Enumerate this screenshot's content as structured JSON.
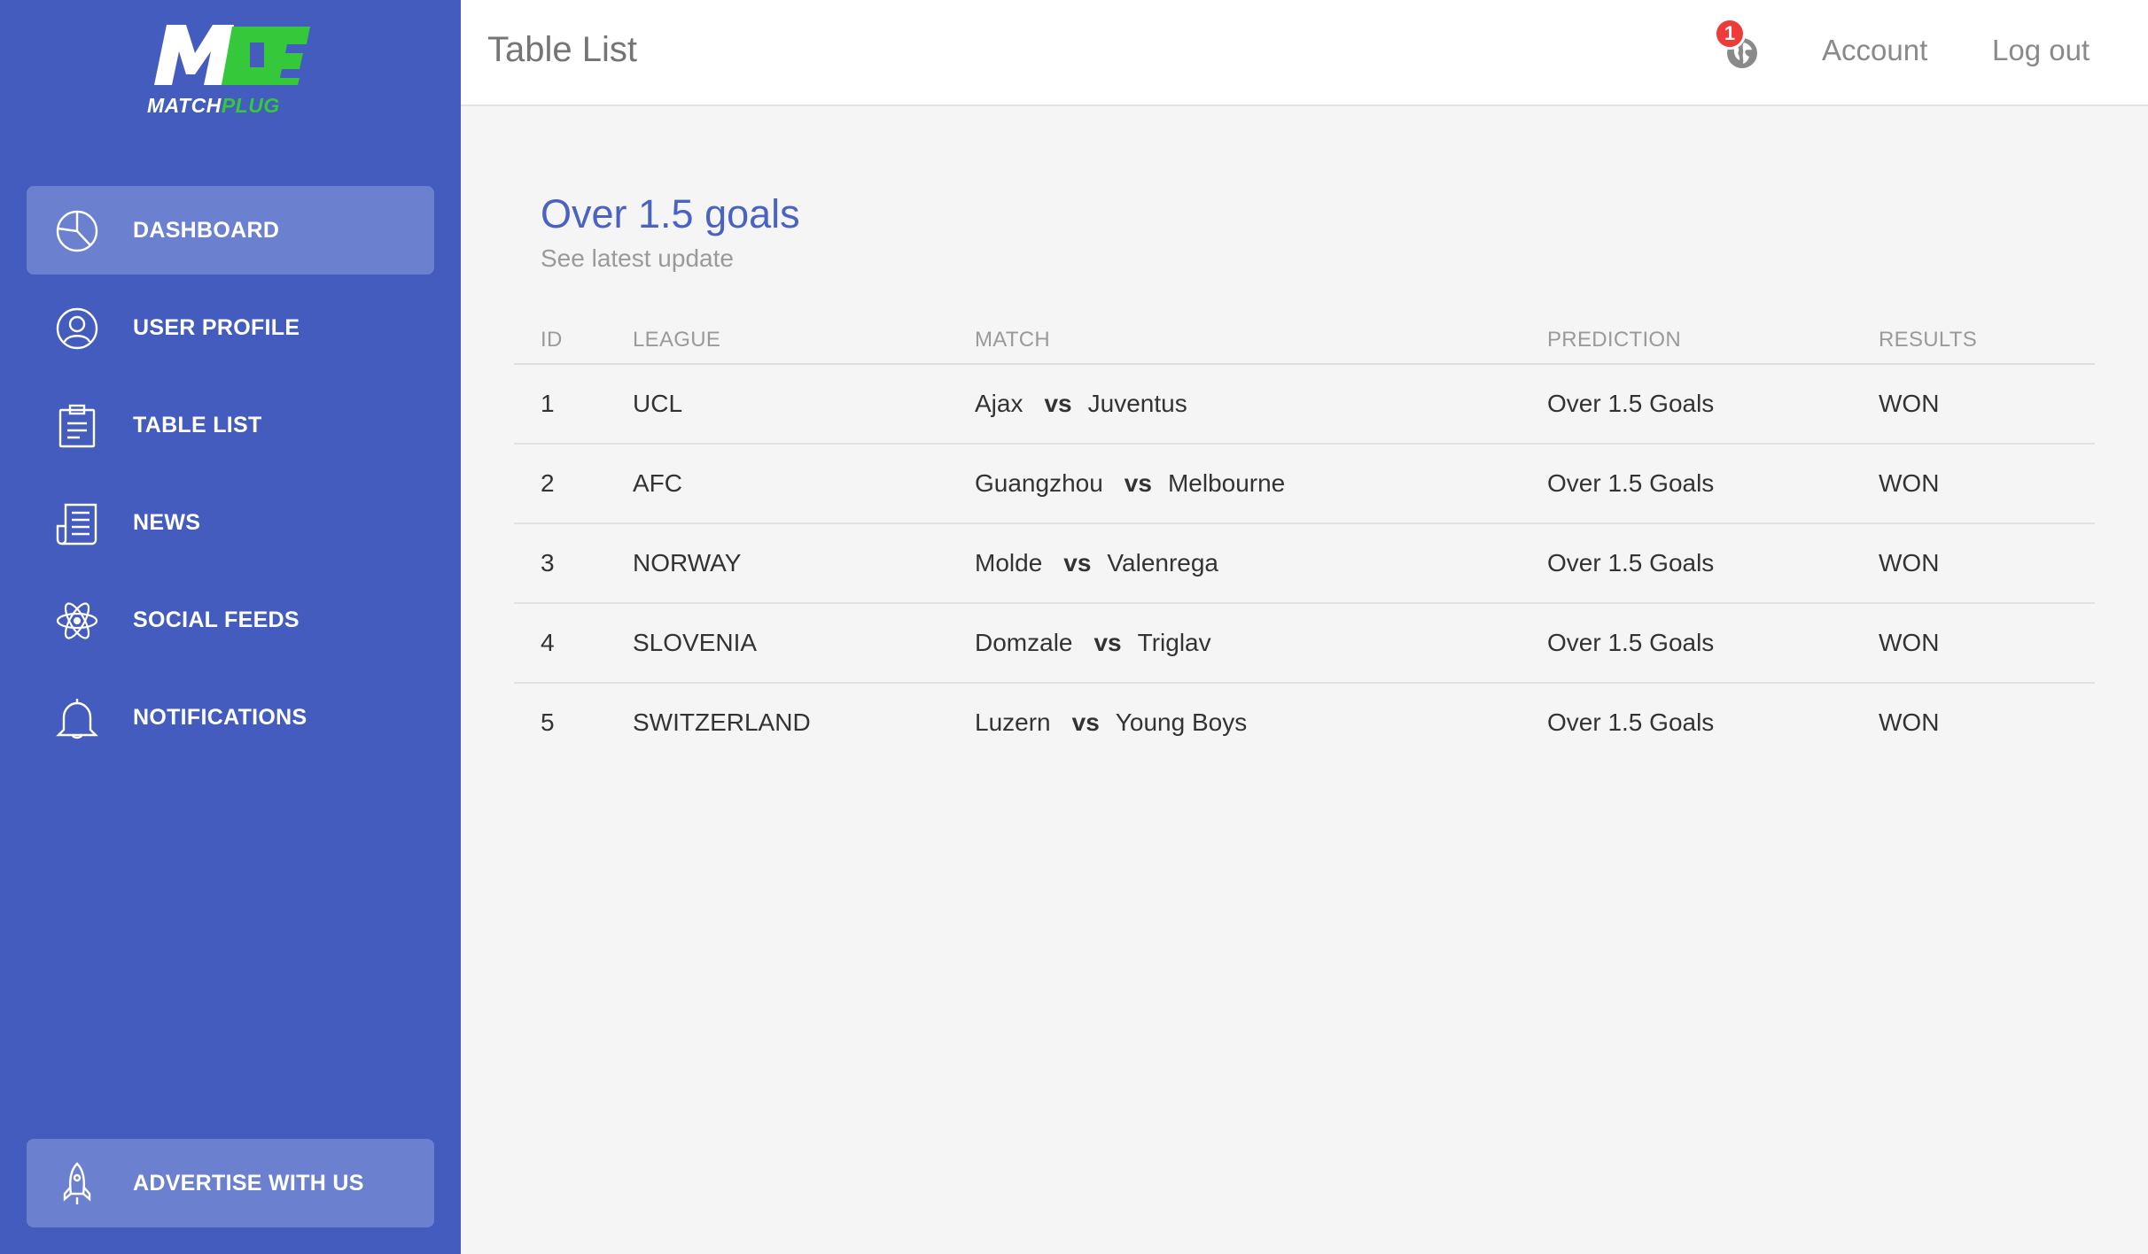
{
  "brand": {
    "name_white": "MATCH",
    "name_green": "PLUG",
    "green": "#34c83a",
    "sidebar_color": "#435cbd"
  },
  "sidebar": {
    "items": [
      {
        "label": "DASHBOARD",
        "icon": "pie-chart-icon",
        "active": true
      },
      {
        "label": "USER PROFILE",
        "icon": "user-icon",
        "active": false
      },
      {
        "label": "TABLE LIST",
        "icon": "clipboard-icon",
        "active": false
      },
      {
        "label": "NEWS",
        "icon": "newspaper-icon",
        "active": false
      },
      {
        "label": "SOCIAL FEEDS",
        "icon": "atom-icon",
        "active": false
      },
      {
        "label": "NOTIFICATIONS",
        "icon": "bell-icon",
        "active": false
      }
    ],
    "advertise_label": "ADVERTISE WITH US"
  },
  "header": {
    "title": "Table List",
    "notification_count": "1",
    "account_label": "Account",
    "logout_label": "Log out"
  },
  "card": {
    "title": "Over 1.5 goals",
    "subtitle": "See latest update"
  },
  "table": {
    "columns": [
      "ID",
      "LEAGUE",
      "MATCH",
      "PREDICTION",
      "RESULTS"
    ],
    "vs_label": "vs",
    "rows": [
      {
        "id": "1",
        "league": "UCL",
        "home": "Ajax",
        "away": "Juventus",
        "prediction": "Over 1.5 Goals",
        "result": "WON"
      },
      {
        "id": "2",
        "league": "AFC",
        "home": "Guangzhou",
        "away": "Melbourne",
        "prediction": "Over 1.5 Goals",
        "result": "WON"
      },
      {
        "id": "3",
        "league": "NORWAY",
        "home": "Molde",
        "away": "Valenrega",
        "prediction": "Over 1.5 Goals",
        "result": "WON"
      },
      {
        "id": "4",
        "league": "SLOVENIA",
        "home": "Domzale",
        "away": "Triglav",
        "prediction": "Over 1.5 Goals",
        "result": "WON"
      },
      {
        "id": "5",
        "league": "SWITZERLAND",
        "home": "Luzern",
        "away": "Young Boys",
        "prediction": "Over 1.5 Goals",
        "result": "WON"
      }
    ]
  }
}
